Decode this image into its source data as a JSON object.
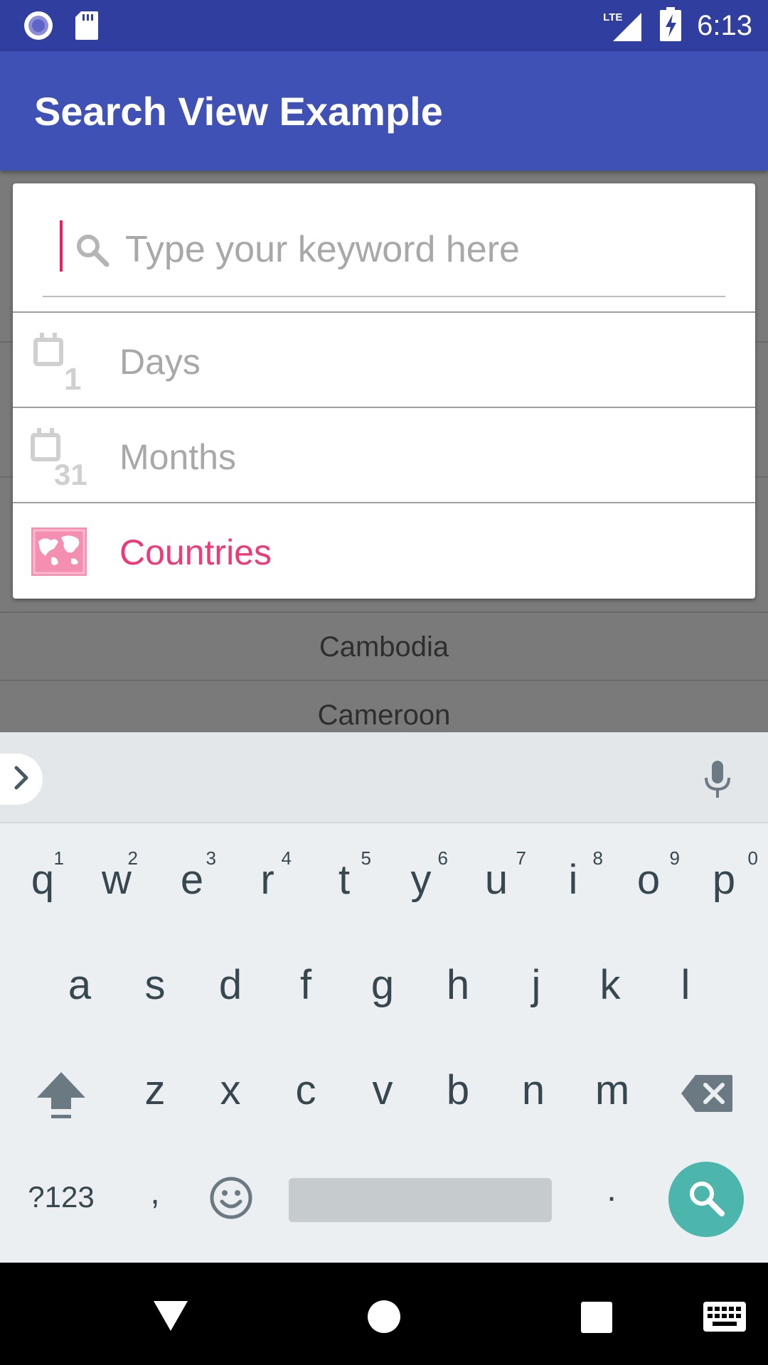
{
  "status_bar": {
    "time": "6:13",
    "network": "LTE",
    "icons": [
      "radio-icon",
      "sd-card-icon",
      "signal-icon",
      "battery-charging-icon"
    ]
  },
  "app_bar": {
    "title": "Search View Example"
  },
  "search": {
    "placeholder": "Type your keyword here",
    "value": ""
  },
  "suggestions": [
    {
      "label": "Days",
      "icon": "calendar-day-icon",
      "active": false
    },
    {
      "label": "Months",
      "icon": "calendar-month-icon",
      "active": false
    },
    {
      "label": "Countries",
      "icon": "world-map-icon",
      "active": true
    }
  ],
  "background_list": [
    "Cambodia",
    "Cameroon"
  ],
  "keyboard": {
    "row1": [
      {
        "letter": "q",
        "hint": "1"
      },
      {
        "letter": "w",
        "hint": "2"
      },
      {
        "letter": "e",
        "hint": "3"
      },
      {
        "letter": "r",
        "hint": "4"
      },
      {
        "letter": "t",
        "hint": "5"
      },
      {
        "letter": "y",
        "hint": "6"
      },
      {
        "letter": "u",
        "hint": "7"
      },
      {
        "letter": "i",
        "hint": "8"
      },
      {
        "letter": "o",
        "hint": "9"
      },
      {
        "letter": "p",
        "hint": "0"
      }
    ],
    "row2": [
      "a",
      "s",
      "d",
      "f",
      "g",
      "h",
      "j",
      "k",
      "l"
    ],
    "row3": [
      "z",
      "x",
      "c",
      "v",
      "b",
      "n",
      "m"
    ],
    "symbols_label": "?123",
    "comma_label": ",",
    "period_label": ".",
    "accent_color": "#4DB6AC"
  },
  "colors": {
    "primary": "#3F51B5",
    "primary_dark": "#303F9F",
    "accent": "#E91E63"
  }
}
